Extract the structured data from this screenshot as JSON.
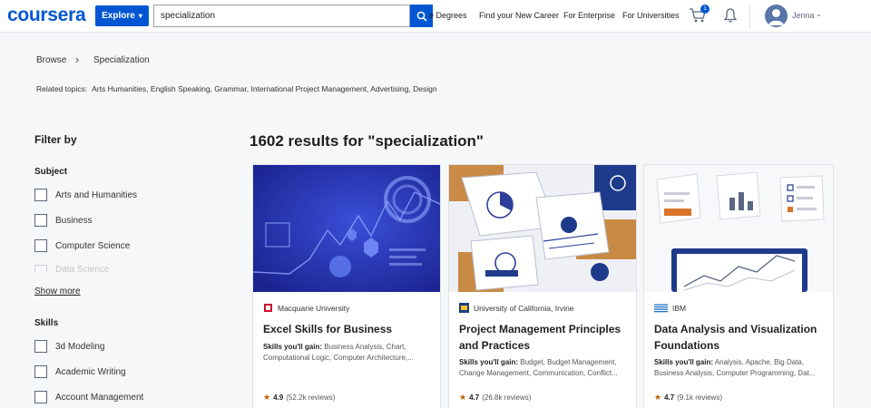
{
  "header": {
    "logo": "coursera",
    "explore_label": "Explore",
    "search_value": "specialization",
    "nav_links": [
      "e Degrees",
      "Find your New Career",
      "For Enterprise",
      "For Universities"
    ],
    "cart_count": "1",
    "user_name": "Jenna"
  },
  "breadcrumb": {
    "browse": "Browse",
    "separator": "›",
    "current": "Specialization"
  },
  "related": {
    "label": "Related topics:",
    "topics": [
      "Arts Humanities,",
      "English Speaking,",
      "Grammar,",
      "International Project Management,",
      "Advertising,",
      "Design"
    ]
  },
  "filters": {
    "title": "Filter by",
    "subject": {
      "heading": "Subject",
      "items": [
        "Arts and Humanities",
        "Business",
        "Computer Science",
        "Data Science"
      ],
      "show_more": "Show more"
    },
    "skills": {
      "heading": "Skills",
      "items": [
        "3d Modeling",
        "Academic Writing",
        "Account Management"
      ]
    }
  },
  "results": {
    "title": "1602 results for \"specialization\"",
    "cards": [
      {
        "partner": "Macquarie University",
        "title": "Excel Skills for Business",
        "skills_label": "Skills you'll gain:",
        "skills": "Business Analysis, Chart, Computational Logic, Computer Architecture,...",
        "rating": "4.9",
        "reviews": "(52.2k reviews)"
      },
      {
        "partner": "University of California, Irvine",
        "title": "Project Management Principles and Practices",
        "skills_label": "Skills you'll gain:",
        "skills": "Budget, Budget Management, Change Management, Communication, Conflict...",
        "rating": "4.7",
        "reviews": "(26.8k reviews)"
      },
      {
        "partner": "IBM",
        "title": "Data Analysis and Visualization Foundations",
        "skills_label": "Skills you'll gain:",
        "skills": "Analysis, Apache, Big Data, Business Analysis, Computer Programming, Dat...",
        "rating": "4.7",
        "reviews": "(9.1k reviews)"
      }
    ]
  },
  "colors": {
    "brand": "#0056d2",
    "star": "#c06000",
    "background": "#f5f7f8"
  },
  "icons": [
    "search-icon",
    "cart-icon",
    "bell-icon",
    "avatar-icon",
    "chevron-down-icon",
    "star-icon"
  ]
}
